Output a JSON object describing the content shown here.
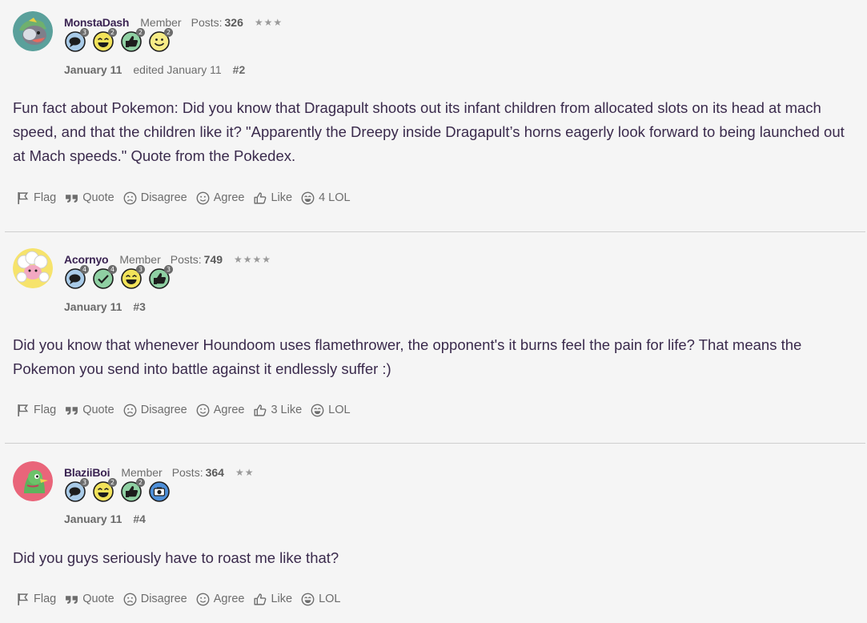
{
  "posts": [
    {
      "username": "MonstaDash",
      "role": "Member",
      "posts_label": "Posts:",
      "posts_count": "326",
      "stars": "★★★",
      "badges": [
        {
          "icon": "comment-badge-icon",
          "level": "3"
        },
        {
          "icon": "lol-badge-icon",
          "level": "2"
        },
        {
          "icon": "like-badge-icon",
          "level": "2"
        },
        {
          "icon": "agree-badge-icon",
          "level": "2"
        }
      ],
      "date": "January 11",
      "edited": "edited January 11",
      "permalink": "#2",
      "body": "Fun fact about Pokemon: Did you know that Dragapult shoots out its infant children from allocated slots on its head at mach speed, and that the children like it? \"Apparently the Dreepy inside Dragapult’s horns eagerly look forward to being launched out at Mach speeds.\" Quote from the Pokedex.",
      "reactions": {
        "flag": "Flag",
        "quote": "Quote",
        "disagree": "Disagree",
        "agree": "Agree",
        "like": "Like",
        "like_count": "",
        "lol": "LOL",
        "lol_count": "4"
      }
    },
    {
      "username": "Acornyo",
      "role": "Member",
      "posts_label": "Posts:",
      "posts_count": "749",
      "stars": "★★★★",
      "badges": [
        {
          "icon": "comment-badge-icon",
          "level": "4"
        },
        {
          "icon": "checkmark-badge-icon",
          "level": "4"
        },
        {
          "icon": "lol-badge-icon",
          "level": "3"
        },
        {
          "icon": "like-badge-icon",
          "level": "3"
        }
      ],
      "date": "January 11",
      "edited": "",
      "permalink": "#3",
      "body": "Did you know that whenever Houndoom uses flamethrower, the opponent's it burns feel the pain for life? That means the Pokemon you send into battle against it endlessly suffer :)",
      "reactions": {
        "flag": "Flag",
        "quote": "Quote",
        "disagree": "Disagree",
        "agree": "Agree",
        "like": "Like",
        "like_count": "3",
        "lol": "LOL",
        "lol_count": ""
      }
    },
    {
      "username": "BlaziiBoi",
      "role": "Member",
      "posts_label": "Posts:",
      "posts_count": "364",
      "stars": "★★",
      "badges": [
        {
          "icon": "comment-badge-icon",
          "level": "3"
        },
        {
          "icon": "lol-badge-icon",
          "level": "2"
        },
        {
          "icon": "like-badge-icon",
          "level": "2"
        },
        {
          "icon": "camera-badge-icon",
          "level": ""
        }
      ],
      "date": "January 11",
      "edited": "",
      "permalink": "#4",
      "body": "Did you guys seriously have to roast me like that?",
      "reactions": {
        "flag": "Flag",
        "quote": "Quote",
        "disagree": "Disagree",
        "agree": "Agree",
        "like": "Like",
        "like_count": "",
        "lol": "LOL",
        "lol_count": ""
      }
    }
  ],
  "colors": {
    "background": "#f5f5f5",
    "username": "#3a2352",
    "body_text": "#3a2a4c",
    "meta_text": "#6d6d6d",
    "divider": "#cfcfcf"
  }
}
